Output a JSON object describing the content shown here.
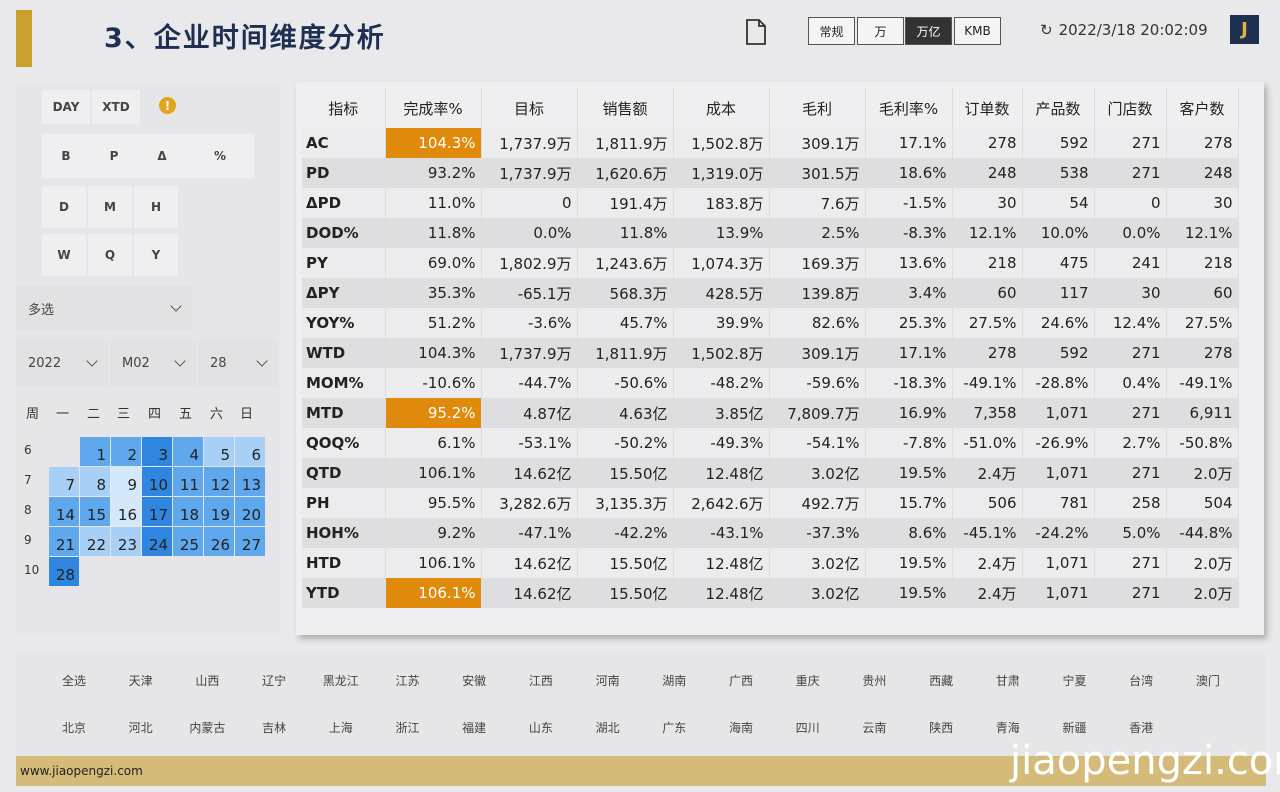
{
  "header": {
    "title": "3、企业时间维度分析",
    "timestamp": "2022/3/18 20:02:09",
    "refresh_icon": "↻",
    "avatar_letter": "J",
    "unit_buttons": [
      "常规",
      "万",
      "万亿",
      "KMB"
    ],
    "active_unit": "万亿"
  },
  "left": {
    "chips_row1": [
      "DAY",
      "XTD"
    ],
    "warn": "!",
    "chips_row2": [
      "B",
      "P",
      "Δ",
      "%"
    ],
    "chips_row3": [
      "D",
      "M",
      "H"
    ],
    "chips_row4": [
      "W",
      "Q",
      "Y"
    ],
    "multi_select": "多选",
    "year": "2022",
    "month": "M02",
    "day": "28"
  },
  "calendar": {
    "headers": [
      "周",
      "一",
      "二",
      "三",
      "四",
      "五",
      "六",
      "日"
    ],
    "weeks": [
      "6",
      "7",
      "8",
      "9",
      "10"
    ]
  },
  "table": {
    "headers": [
      "指标",
      "完成率%",
      "目标",
      "销售额",
      "成本",
      "毛利",
      "毛利率%",
      "订单数",
      "产品数",
      "门店数",
      "客户数"
    ],
    "rows": [
      [
        "AC",
        "104.3%",
        "1,737.9万",
        "1,811.9万",
        "1,502.8万",
        "309.1万",
        "17.1%",
        "278",
        "592",
        "271",
        "278"
      ],
      [
        "PD",
        "93.2%",
        "1,737.9万",
        "1,620.6万",
        "1,319.0万",
        "301.5万",
        "18.6%",
        "248",
        "538",
        "271",
        "248"
      ],
      [
        "ΔPD",
        "11.0%",
        "0",
        "191.4万",
        "183.8万",
        "7.6万",
        "-1.5%",
        "30",
        "54",
        "0",
        "30"
      ],
      [
        "DOD%",
        "11.8%",
        "0.0%",
        "11.8%",
        "13.9%",
        "2.5%",
        "-8.3%",
        "12.1%",
        "10.0%",
        "0.0%",
        "12.1%"
      ],
      [
        "PY",
        "69.0%",
        "1,802.9万",
        "1,243.6万",
        "1,074.3万",
        "169.3万",
        "13.6%",
        "218",
        "475",
        "241",
        "218"
      ],
      [
        "ΔPY",
        "35.3%",
        "-65.1万",
        "568.3万",
        "428.5万",
        "139.8万",
        "3.4%",
        "60",
        "117",
        "30",
        "60"
      ],
      [
        "YOY%",
        "51.2%",
        "-3.6%",
        "45.7%",
        "39.9%",
        "82.6%",
        "25.3%",
        "27.5%",
        "24.6%",
        "12.4%",
        "27.5%"
      ],
      [
        "WTD",
        "104.3%",
        "1,737.9万",
        "1,811.9万",
        "1,502.8万",
        "309.1万",
        "17.1%",
        "278",
        "592",
        "271",
        "278"
      ],
      [
        "MOM%",
        "-10.6%",
        "-44.7%",
        "-50.6%",
        "-48.2%",
        "-59.6%",
        "-18.3%",
        "-49.1%",
        "-28.8%",
        "0.4%",
        "-49.1%"
      ],
      [
        "MTD",
        "95.2%",
        "4.87亿",
        "4.63亿",
        "3.85亿",
        "7,809.7万",
        "16.9%",
        "7,358",
        "1,071",
        "271",
        "6,911"
      ],
      [
        "QOQ%",
        "6.1%",
        "-53.1%",
        "-50.2%",
        "-49.3%",
        "-54.1%",
        "-7.8%",
        "-51.0%",
        "-26.9%",
        "2.7%",
        "-50.8%"
      ],
      [
        "QTD",
        "106.1%",
        "14.62亿",
        "15.50亿",
        "12.48亿",
        "3.02亿",
        "19.5%",
        "2.4万",
        "1,071",
        "271",
        "2.0万"
      ],
      [
        "PH",
        "95.5%",
        "3,282.6万",
        "3,135.3万",
        "2,642.6万",
        "492.7万",
        "15.7%",
        "506",
        "781",
        "258",
        "504"
      ],
      [
        "HOH%",
        "9.2%",
        "-47.1%",
        "-42.2%",
        "-43.1%",
        "-37.3%",
        "8.6%",
        "-45.1%",
        "-24.2%",
        "5.0%",
        "-44.8%"
      ],
      [
        "HTD",
        "106.1%",
        "14.62亿",
        "15.50亿",
        "12.48亿",
        "3.02亿",
        "19.5%",
        "2.4万",
        "1,071",
        "271",
        "2.0万"
      ],
      [
        "YTD",
        "106.1%",
        "14.62亿",
        "15.50亿",
        "12.48亿",
        "3.02亿",
        "19.5%",
        "2.4万",
        "1,071",
        "271",
        "2.0万"
      ]
    ],
    "highlight_rows": [
      "AC",
      "MTD",
      "YTD"
    ],
    "highlight_color": "#e08a0b"
  },
  "provinces": {
    "row1": [
      "全选",
      "天津",
      "山西",
      "辽宁",
      "黑龙江",
      "江苏",
      "安徽",
      "江西",
      "河南",
      "湖南",
      "广西",
      "重庆",
      "贵州",
      "西藏",
      "甘肃",
      "宁夏",
      "台湾",
      "澳门"
    ],
    "row2": [
      "北京",
      "河北",
      "内蒙古",
      "吉林",
      "上海",
      "浙江",
      "福建",
      "山东",
      "湖北",
      "广东",
      "海南",
      "四川",
      "云南",
      "陕西",
      "青海",
      "新疆",
      "香港"
    ]
  },
  "footer": {
    "url": "www.jiaopengzi.com",
    "watermark": "jiaopengzi.com"
  },
  "colors": {
    "accent": "#c9a02f",
    "title": "#1e2f52",
    "cal_dark": "#2f86e0",
    "cal_mid": "#60a8ee",
    "cal_light": "#a8d0f6",
    "cal_pale": "#d3e8fb"
  }
}
